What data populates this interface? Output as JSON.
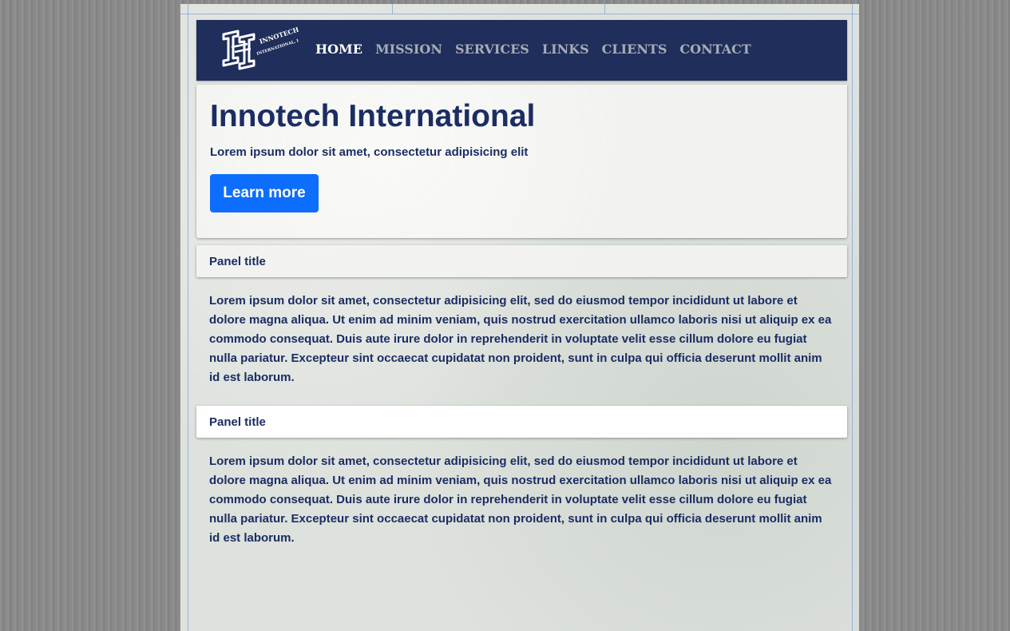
{
  "brand": {
    "logo_name": "Innotech International LLC logo"
  },
  "nav": {
    "items": [
      {
        "label": "HOME",
        "active": true
      },
      {
        "label": "MISSION",
        "active": false
      },
      {
        "label": "SERVICES",
        "active": false
      },
      {
        "label": "LINKS",
        "active": false
      },
      {
        "label": "CLIENTS",
        "active": false
      },
      {
        "label": "CONTACT",
        "active": false
      }
    ]
  },
  "hero": {
    "title": "Innotech International",
    "subtitle": "Lorem ipsum dolor sit amet, consectetur adipisicing elit",
    "button_label": "Learn more"
  },
  "panels": [
    {
      "title": "Panel title",
      "body": "Lorem ipsum dolor sit amet, consectetur adipisicing elit, sed do eiusmod tempor incididunt ut labore et dolore magna aliqua. Ut enim ad minim veniam, quis nostrud exercitation ullamco laboris nisi ut aliquip ex ea commodo consequat. Duis aute irure dolor in reprehenderit in voluptate velit esse cillum dolore eu fugiat nulla pariatur. Excepteur sint occaecat cupidatat non proident, sunt in culpa qui officia deserunt mollit anim id est laborum."
    },
    {
      "title": "Panel title",
      "body": "Lorem ipsum dolor sit amet, consectetur adipisicing elit, sed do eiusmod tempor incididunt ut labore et dolore magna aliqua. Ut enim ad minim veniam, quis nostrud exercitation ullamco laboris nisi ut aliquip ex ea commodo consequat. Duis aute irure dolor in reprehenderit in voluptate velit esse cillum dolore eu fugiat nulla pariatur. Excepteur sint occaecat cupidatat non proident, sunt in culpa qui officia deserunt mollit anim id est laborum."
    }
  ],
  "colors": {
    "navbar": "#1f2e5a",
    "text_primary": "#1b2d63",
    "button": "#0d6efd",
    "nav_inactive": "#a8acb8",
    "nav_active": "#ffffff"
  }
}
